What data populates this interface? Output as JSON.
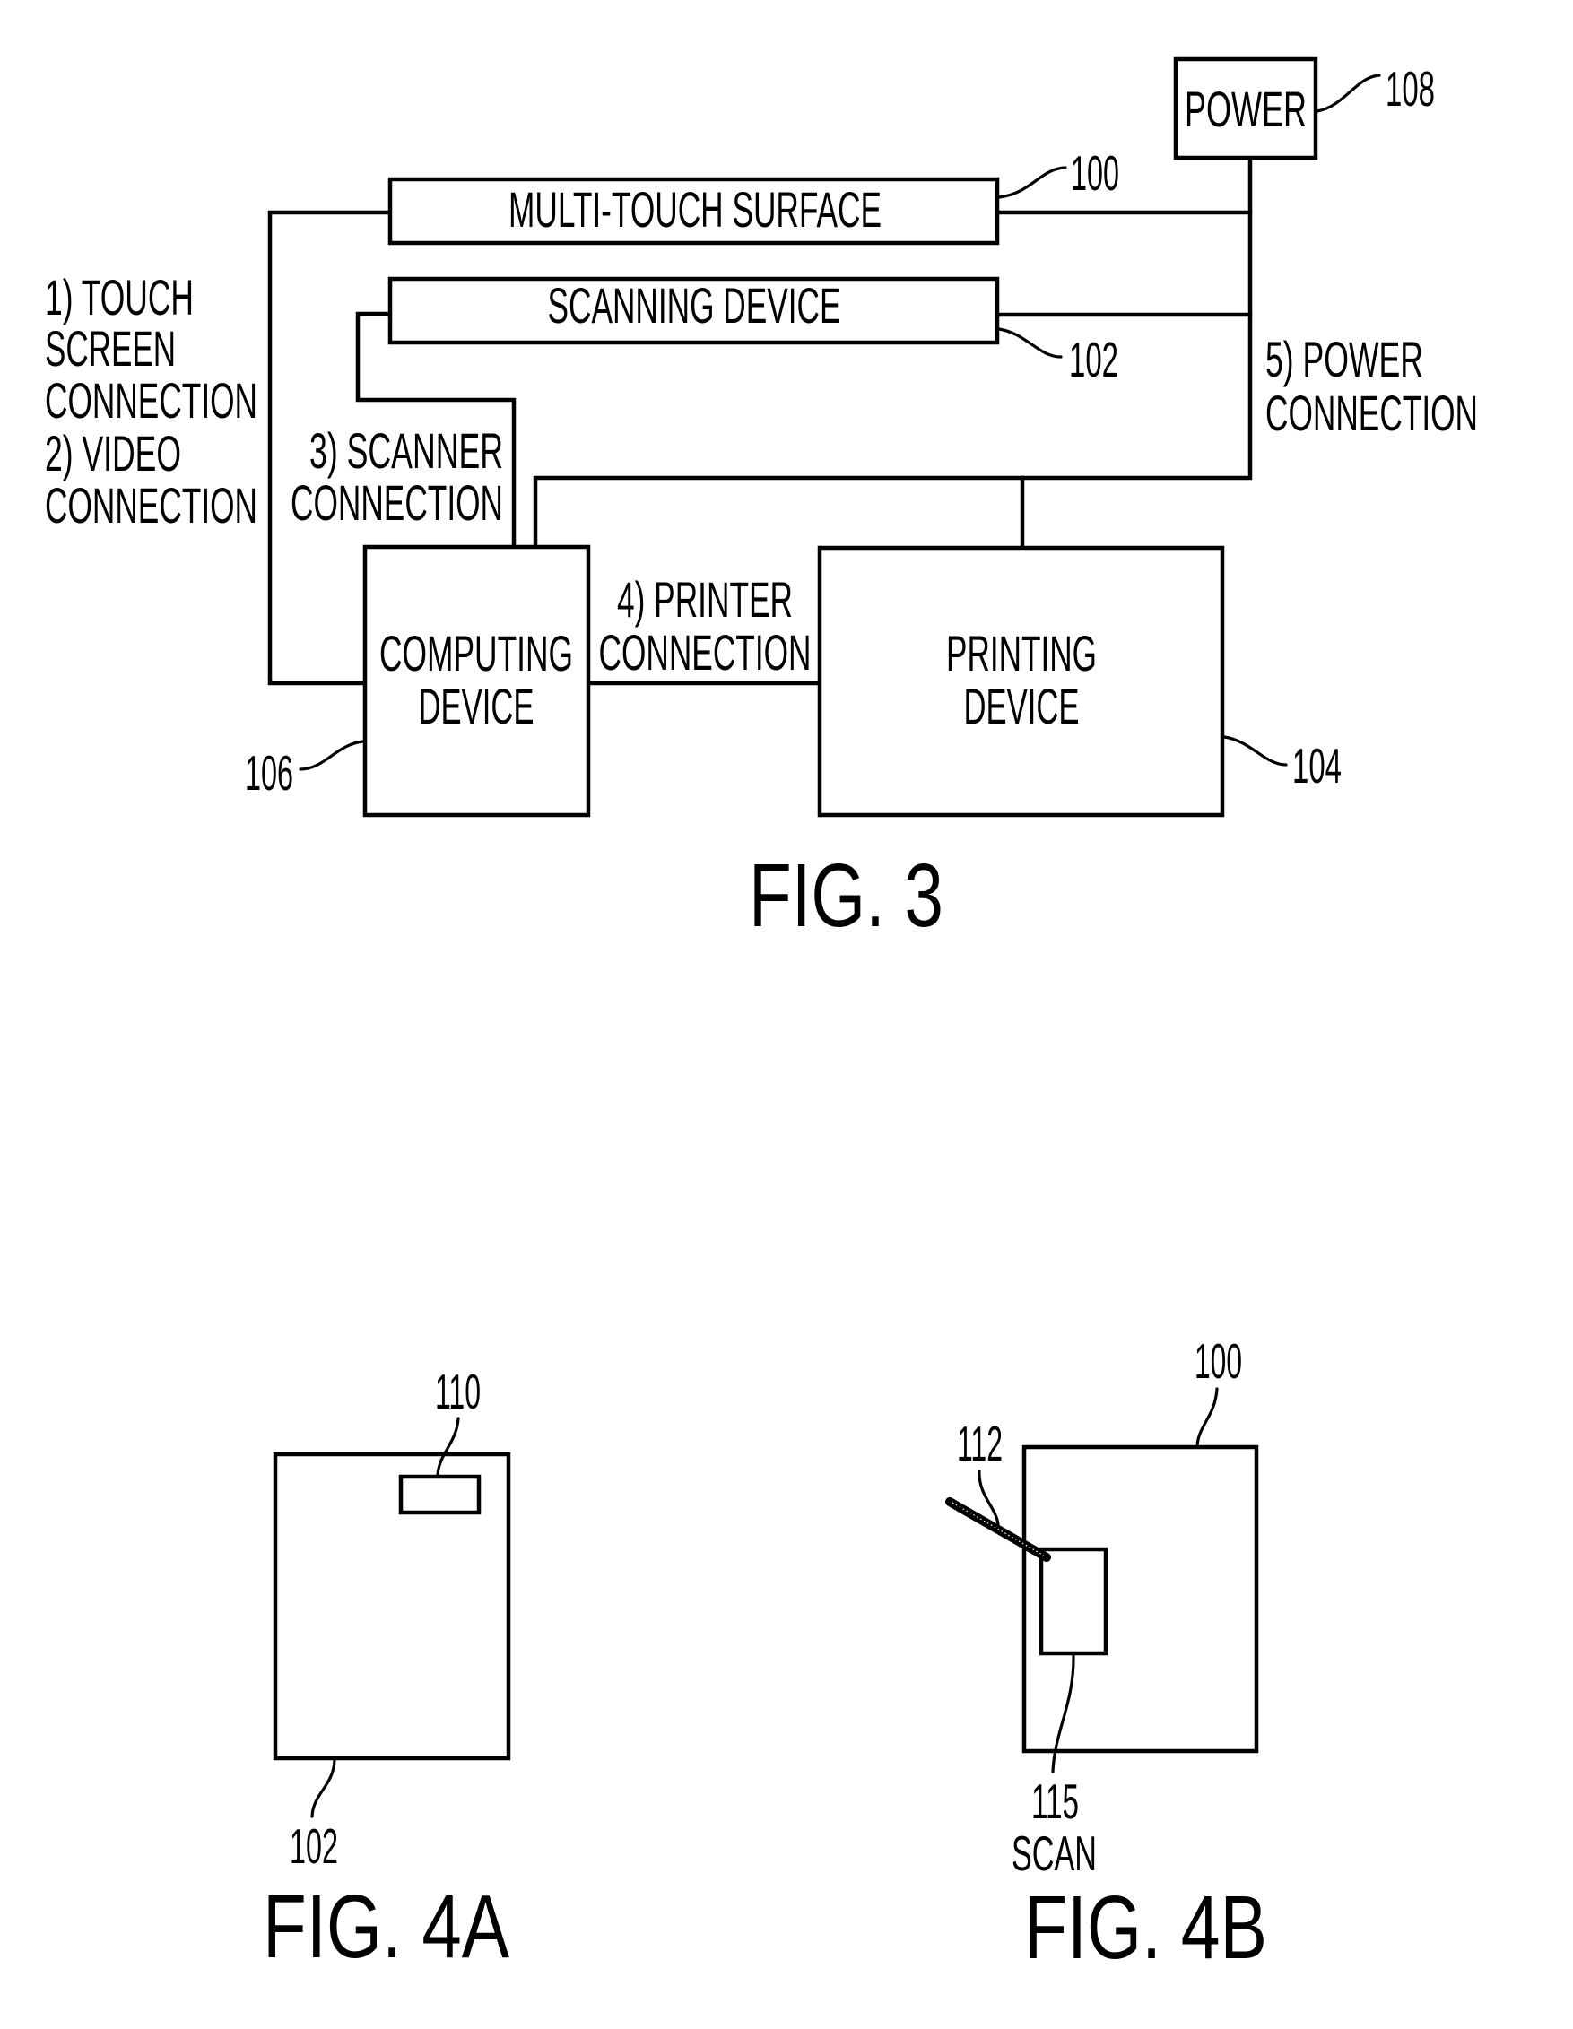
{
  "figure3": {
    "caption": "FIG. 3",
    "blocks": {
      "multi_touch_surface": {
        "label": "MULTI-TOUCH SURFACE",
        "ref": "100"
      },
      "scanning_device": {
        "label": "SCANNING DEVICE",
        "ref": "102"
      },
      "power": {
        "label": "POWER",
        "ref": "108"
      },
      "computing_device": {
        "label_lines": [
          "COMPUTING",
          "DEVICE"
        ],
        "ref": "106"
      },
      "printing_device": {
        "label_lines": [
          "PRINTING",
          "DEVICE"
        ],
        "ref": "104"
      }
    },
    "connections": {
      "touch_video": [
        "1) TOUCH",
        "SCREEN",
        "CONNECTION",
        "2) VIDEO",
        "CONNECTION"
      ],
      "scanner": [
        "3) SCANNER",
        "CONNECTION"
      ],
      "printer": [
        "4) PRINTER",
        "CONNECTION"
      ],
      "power": [
        "5) POWER",
        "CONNECTION"
      ]
    }
  },
  "figure4a": {
    "caption": "FIG. 4A",
    "device_ref": "102",
    "window_ref": "110"
  },
  "figure4b": {
    "caption": "FIG. 4B",
    "surface_ref": "100",
    "stylus_ref": "112",
    "scan_ref": "115",
    "scan_label": "SCAN"
  },
  "colors": {
    "ink": "#000000",
    "paper": "#ffffff"
  }
}
